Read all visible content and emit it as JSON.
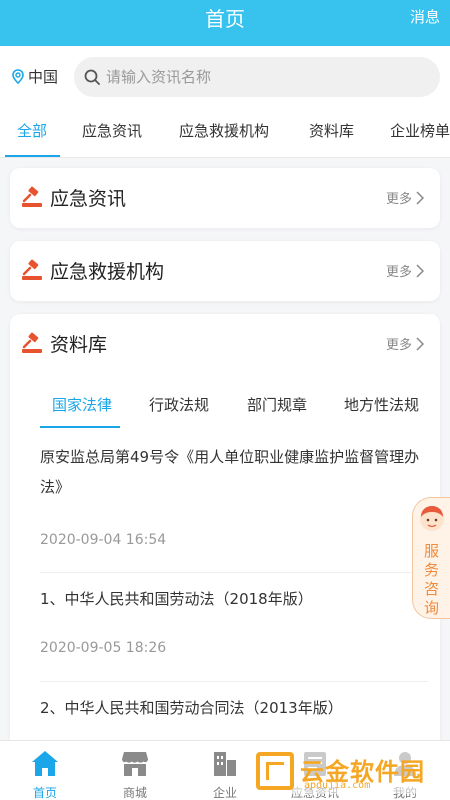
{
  "header": {
    "title": "首页",
    "messages": "消息"
  },
  "location": "中国",
  "search": {
    "placeholder": "请输入资讯名称"
  },
  "tabs": [
    {
      "label": "全部",
      "active": true
    },
    {
      "label": "应急资讯"
    },
    {
      "label": "应急救援机构"
    },
    {
      "label": "资料库"
    },
    {
      "label": "企业榜单"
    }
  ],
  "sections": [
    {
      "title": "应急资讯",
      "more": "更多"
    },
    {
      "title": "应急救援机构",
      "more": "更多"
    },
    {
      "title": "资料库",
      "more": "更多"
    }
  ],
  "library": {
    "subtabs": [
      {
        "label": "国家法律",
        "active": true
      },
      {
        "label": "行政法规"
      },
      {
        "label": "部门规章"
      },
      {
        "label": "地方性法规"
      }
    ],
    "articles": [
      {
        "title": "原安监总局第49号令《用人单位职业健康监护监督管理办法》",
        "date": "2020-09-04 16:54"
      },
      {
        "title": "1、中华人民共和国劳动法（2018年版）",
        "date": "2020-09-05 18:26"
      },
      {
        "title": "2、中华人民共和国劳动合同法（2013年版）",
        "date": ""
      }
    ]
  },
  "float_service": {
    "label": "服务咨询"
  },
  "tabbar": [
    {
      "label": "首页",
      "icon": "home-icon",
      "active": true
    },
    {
      "label": "商城",
      "icon": "store-icon"
    },
    {
      "label": "企业",
      "icon": "building-icon"
    },
    {
      "label": "应急资讯",
      "icon": "news-icon"
    },
    {
      "label": "我的",
      "icon": "person-icon"
    }
  ],
  "watermark": {
    "text": "云金软件园",
    "url": "apoujia.com"
  },
  "colors": {
    "primary": "#37c3ee",
    "accent": "#1aa6e8",
    "icon_red": "#e8532f",
    "service": "#f08a3c"
  }
}
